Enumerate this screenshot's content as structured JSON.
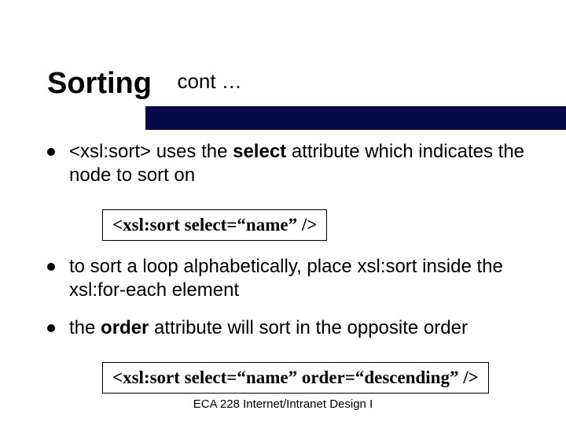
{
  "title": "Sorting",
  "subtitle": "cont …",
  "bullets": [
    {
      "pre": "<xsl:sort> uses the ",
      "bold": "select",
      "post": " attribute which indicates the node to sort on"
    },
    {
      "pre": "to sort a loop alphabetically, place xsl:sort inside the xsl:for-each element",
      "bold": "",
      "post": ""
    },
    {
      "pre": "the ",
      "bold": "order",
      "post": " attribute will sort in the opposite order"
    }
  ],
  "code1": "<xsl:sort select=“name”  />",
  "code2": "<xsl:sort select=“name” order=“descending” />",
  "footer": "ECA 228  Internet/Intranet Design I"
}
